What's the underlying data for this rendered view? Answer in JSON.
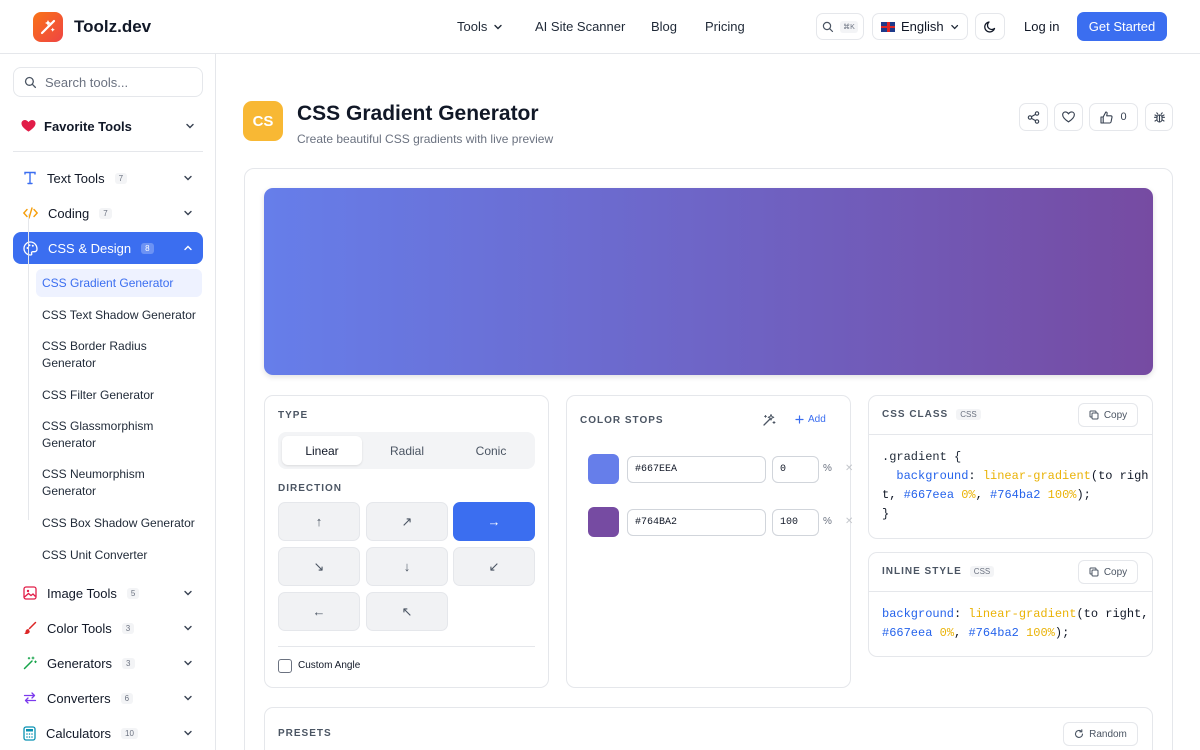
{
  "header": {
    "logo_text": "Toolz.dev",
    "nav": {
      "tools": "Tools",
      "scanner": "AI Site Scanner",
      "blog": "Blog",
      "pricing": "Pricing"
    },
    "search_kbd": "⌘K",
    "language": "English",
    "login": "Log in",
    "get_started": "Get Started",
    "accent_color": "#3b6ef0"
  },
  "sidebar": {
    "search_placeholder": "Search tools...",
    "favorites": "Favorite Tools",
    "categories": [
      {
        "label": "Text Tools",
        "count": "7"
      },
      {
        "label": "Coding",
        "count": "7"
      },
      {
        "label": "CSS & Design",
        "count": "8"
      },
      {
        "label": "Image Tools",
        "count": "5"
      },
      {
        "label": "Color Tools",
        "count": "3"
      },
      {
        "label": "Generators",
        "count": "3"
      },
      {
        "label": "Converters",
        "count": "6"
      },
      {
        "label": "Calculators",
        "count": "10"
      }
    ],
    "css_tools": [
      "CSS Gradient Generator",
      "CSS Text Shadow Generator",
      "CSS Border Radius Generator",
      "CSS Filter Generator",
      "CSS Glassmorphism Generator",
      "CSS Neumorphism Generator",
      "CSS Box Shadow Generator",
      "CSS Unit Converter"
    ]
  },
  "tool": {
    "icon_text": "CS",
    "title": "CSS Gradient Generator",
    "subtitle": "Create beautiful CSS gradients with live preview",
    "likes": "0"
  },
  "controls": {
    "type_label": "TYPE",
    "types": [
      "Linear",
      "Radial",
      "Conic"
    ],
    "selected_type": "Linear",
    "direction_label": "DIRECTION",
    "directions": [
      "↑",
      "↗",
      "→",
      "↘",
      "↓",
      "↙",
      "←",
      "↖"
    ],
    "selected_direction": "→",
    "custom_angle": "Custom Angle"
  },
  "color_stops": {
    "label": "COLOR STOPS",
    "add": "Add",
    "unit": "%",
    "stops": [
      {
        "hex": "#667EEA",
        "color": "#667eea",
        "pos": "0"
      },
      {
        "hex": "#764BA2",
        "color": "#764ba2",
        "pos": "100"
      }
    ]
  },
  "output": {
    "css_class_label": "CSS CLASS",
    "inline_label": "INLINE STYLE",
    "tag": "CSS",
    "copy": "Copy",
    "class_code": {
      "selector": ".gradient {",
      "prop": "background",
      "fn": "linear-gradient",
      "dir": "to righ",
      "dir_wrap": "t",
      "c1": "#667eea",
      "p1": "0%",
      "c2": "#764ba2",
      "p2": "100%",
      "close": "}"
    },
    "inline_code": {
      "prop": "background",
      "fn": "linear-gradient",
      "dir": "to right,",
      "c1": "#667eea",
      "p1": "0%",
      "c2": "#764ba2",
      "p2": "100%"
    }
  },
  "presets": {
    "label": "PRESETS",
    "random": "Random"
  }
}
